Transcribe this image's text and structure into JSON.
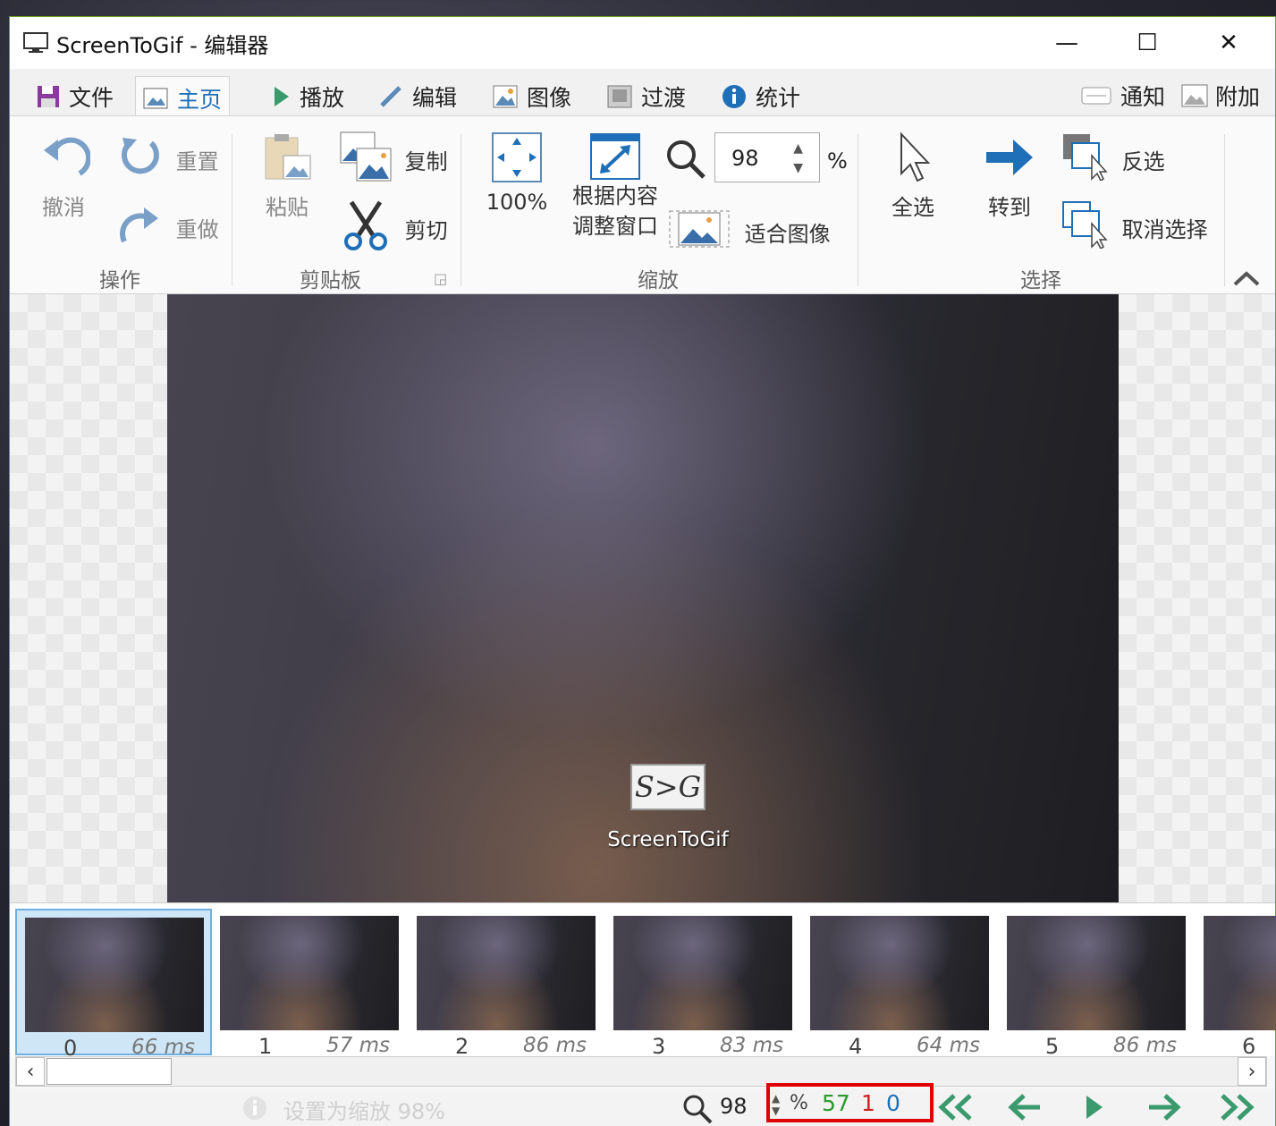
{
  "window": {
    "title": "ScreenToGif - 编辑器",
    "controls": {
      "minimize": "—",
      "maximize": "☐",
      "close": "✕"
    }
  },
  "tabs": [
    {
      "label": "文件",
      "icon": "save-icon"
    },
    {
      "label": "主页",
      "icon": "image-icon",
      "active": true
    },
    {
      "label": "播放",
      "icon": "play-icon"
    },
    {
      "label": "编辑",
      "icon": "pencil-icon"
    },
    {
      "label": "图像",
      "icon": "picture-icon"
    },
    {
      "label": "过渡",
      "icon": "transition-icon"
    },
    {
      "label": "统计",
      "icon": "info-icon"
    }
  ],
  "tab_right": {
    "notify": "通知",
    "extras": "附加"
  },
  "ribbon": {
    "actions": {
      "undo": "撤消",
      "reset": "重置",
      "redo": "重做",
      "group": "操作"
    },
    "clipboard": {
      "paste": "粘贴",
      "copy": "复制",
      "cut": "剪切",
      "group": "剪贴板"
    },
    "zoom": {
      "full": "100%",
      "fit_window": "根据内容调整窗口",
      "fit_window_line1": "根据内容",
      "fit_window_line2": "调整窗口",
      "value": "98",
      "unit": "%",
      "fit_image": "适合图像",
      "group": "缩放"
    },
    "select": {
      "all": "全选",
      "goto": "转到",
      "invert": "反选",
      "deselect": "取消选择",
      "group": "选择"
    }
  },
  "canvas": {
    "desktop_icon_label": "ScreenToGif",
    "logo_text": "S>G"
  },
  "frames": [
    {
      "index": "0",
      "duration": "66 ms",
      "selected": true
    },
    {
      "index": "1",
      "duration": "57 ms"
    },
    {
      "index": "2",
      "duration": "86 ms"
    },
    {
      "index": "3",
      "duration": "83 ms"
    },
    {
      "index": "4",
      "duration": "64 ms"
    },
    {
      "index": "5",
      "duration": "86 ms"
    },
    {
      "index": "6",
      "duration": ""
    }
  ],
  "statusbar": {
    "message": "设置为缩放 98%",
    "zoom_value": "98",
    "zoom_unit": "%",
    "frame_count": "57",
    "selected_count": "1",
    "current_frame": "0",
    "colors": {
      "count": "#2a9a2a",
      "selected": "#d02020",
      "current": "#1f6fb8",
      "highlight": "#e00000"
    }
  },
  "colors": {
    "accent": "#1f6fb8",
    "nav": "#3a9a6e",
    "window_border": "#6fa01e"
  }
}
